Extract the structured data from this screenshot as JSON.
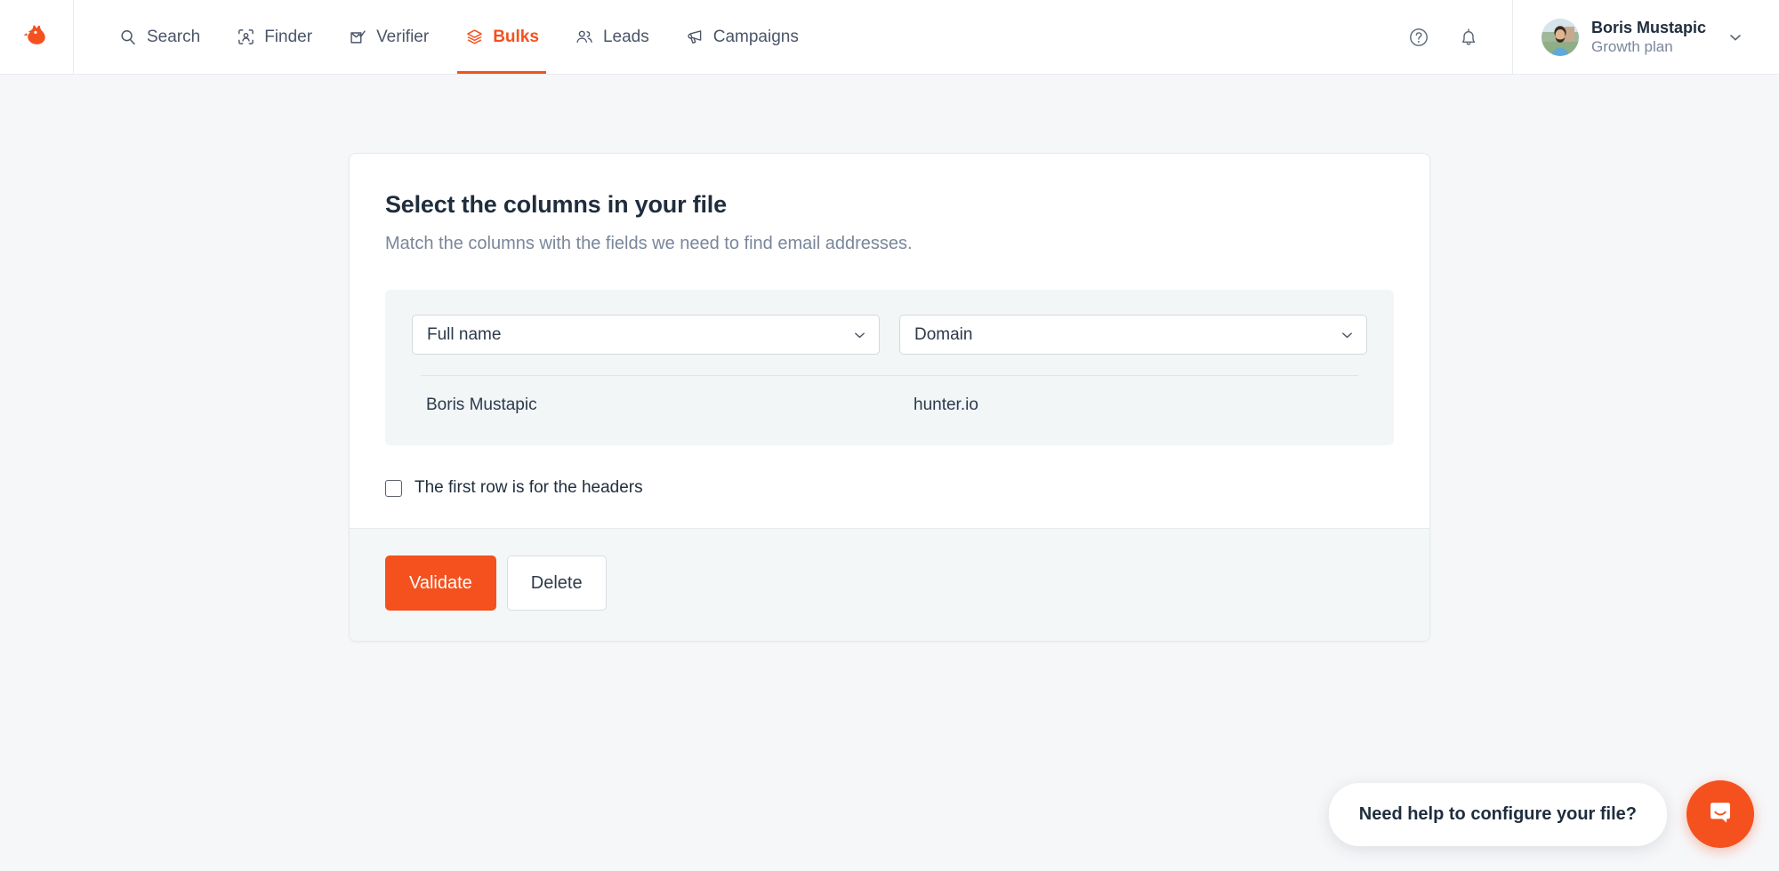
{
  "brand": {
    "logo_icon": "hunter-fox-logo",
    "accent_color": "#f4511e",
    "text_color": "#1f2d3d",
    "muted_color": "#7a869a",
    "page_bg": "#f6f7f9",
    "panel_bg": "#f2f6f7",
    "footer_bg": "#f4f7f8"
  },
  "header": {
    "nav": [
      {
        "label": "Search",
        "icon": "search-icon",
        "active": false
      },
      {
        "label": "Finder",
        "icon": "finder-icon",
        "active": false
      },
      {
        "label": "Verifier",
        "icon": "verifier-icon",
        "active": false
      },
      {
        "label": "Bulks",
        "icon": "bulks-icon",
        "active": true
      },
      {
        "label": "Leads",
        "icon": "leads-icon",
        "active": false
      },
      {
        "label": "Campaigns",
        "icon": "campaigns-icon",
        "active": false
      }
    ],
    "help_icon": "help-circle-icon",
    "notifications_icon": "bell-icon",
    "account": {
      "name": "Boris Mustapic",
      "plan": "Growth plan",
      "avatar_icon": "user-avatar",
      "caret_icon": "chevron-down-icon"
    }
  },
  "card": {
    "title": "Select the columns in your file",
    "subtitle": "Match the columns with the fields we need to find email addresses.",
    "mapper": {
      "columns": [
        {
          "selected": "Full name",
          "caret_icon": "chevron-down-icon",
          "preview": "Boris Mustapic"
        },
        {
          "selected": "Domain",
          "caret_icon": "chevron-down-icon",
          "preview": "hunter.io"
        }
      ]
    },
    "header_checkbox": {
      "label": "The first row is for the headers",
      "checked": false
    },
    "footer": {
      "primary_label": "Validate",
      "secondary_label": "Delete"
    }
  },
  "chat": {
    "prompt": "Need help to configure your file?",
    "launcher_icon": "intercom-chat-icon"
  }
}
